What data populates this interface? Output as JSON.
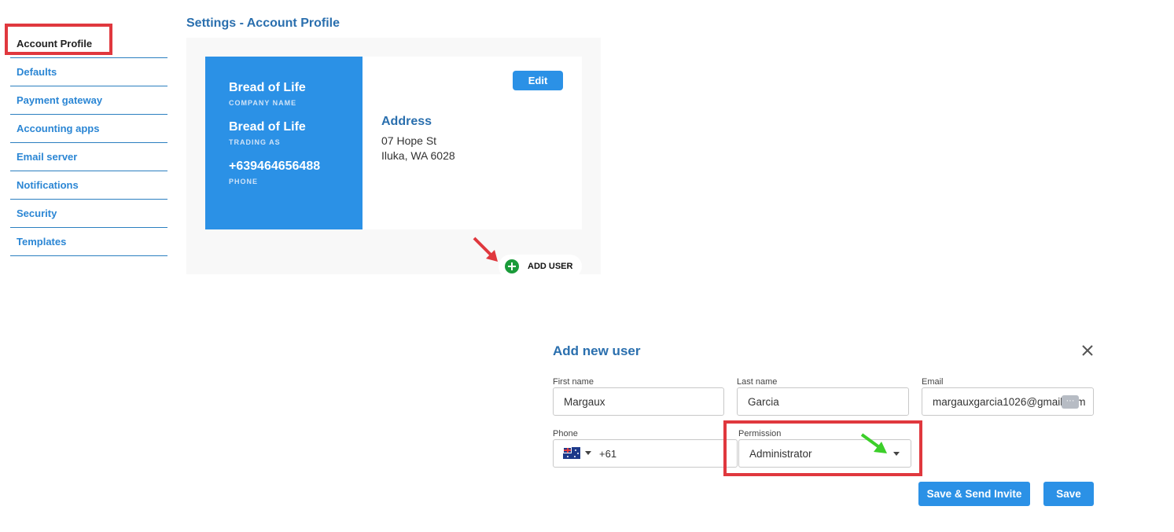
{
  "sidebar": {
    "items": [
      {
        "label": "Account Profile",
        "active": true
      },
      {
        "label": "Defaults"
      },
      {
        "label": "Payment gateway"
      },
      {
        "label": "Accounting apps"
      },
      {
        "label": "Email server"
      },
      {
        "label": "Notifications"
      },
      {
        "label": "Security"
      },
      {
        "label": "Templates"
      }
    ]
  },
  "header": {
    "title": "Settings - Account Profile"
  },
  "profile": {
    "company_name": "Bread of Life",
    "company_name_label": "COMPANY NAME",
    "trading_as": "Bread of Life",
    "trading_as_label": "TRADING AS",
    "phone": "+639464656488",
    "phone_label": "PHONE",
    "edit_label": "Edit",
    "address_title": "Address",
    "address_line1": "07 Hope St",
    "address_line2": "Iluka, WA 6028",
    "add_user_label": "ADD USER"
  },
  "modal": {
    "title": "Add new user",
    "first_name_label": "First name",
    "first_name_value": "Margaux",
    "last_name_label": "Last name",
    "last_name_value": "Garcia",
    "email_label": "Email",
    "email_value": "margauxgarcia1026@gmail.com",
    "phone_label": "Phone",
    "phone_code": "+61",
    "phone_flag_icon": "australia-flag-icon",
    "permission_label": "Permission",
    "permission_value": "Administrator",
    "save_send_label": "Save & Send Invite",
    "save_label": "Save"
  },
  "colors": {
    "accent": "#2b91e6",
    "title": "#2a6fae",
    "highlight": "#e0383e",
    "add_icon": "#1a9b3a",
    "pointer_green": "#3ccf2a"
  }
}
